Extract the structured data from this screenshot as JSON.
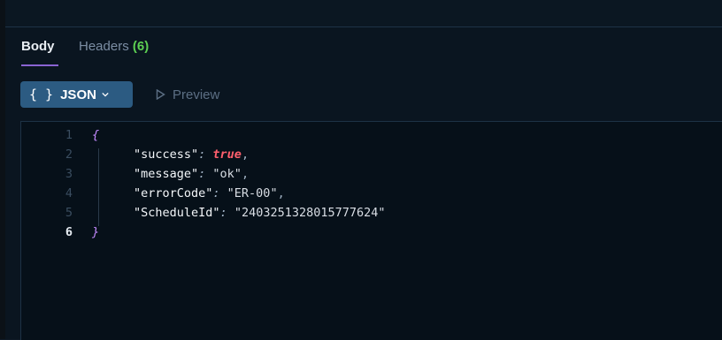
{
  "tabs": {
    "body_label": "Body",
    "headers_label": "Headers",
    "headers_count": "(6)"
  },
  "toolbar": {
    "format_label": "JSON",
    "format_icon": "braces-icon",
    "preview_label": "Preview"
  },
  "response": {
    "lines": [
      {
        "num": "1",
        "open": "{"
      },
      {
        "num": "2",
        "key": "\"success\"",
        "value": "true",
        "type": "bool",
        "comma": ","
      },
      {
        "num": "3",
        "key": "\"message\"",
        "value": "\"ok\"",
        "type": "str",
        "comma": ","
      },
      {
        "num": "4",
        "key": "\"errorCode\"",
        "value": "\"ER-00\"",
        "type": "str",
        "comma": ","
      },
      {
        "num": "5",
        "key": "\"ScheduleId\"",
        "value": "\"2403251328015777624\"",
        "type": "str",
        "comma": ""
      },
      {
        "num": "6",
        "close": "}"
      }
    ]
  },
  "colors": {
    "accent": "#8a63d2",
    "button": "#2c5b82",
    "bool": "#ff5f6d",
    "count": "#5ccf52"
  }
}
